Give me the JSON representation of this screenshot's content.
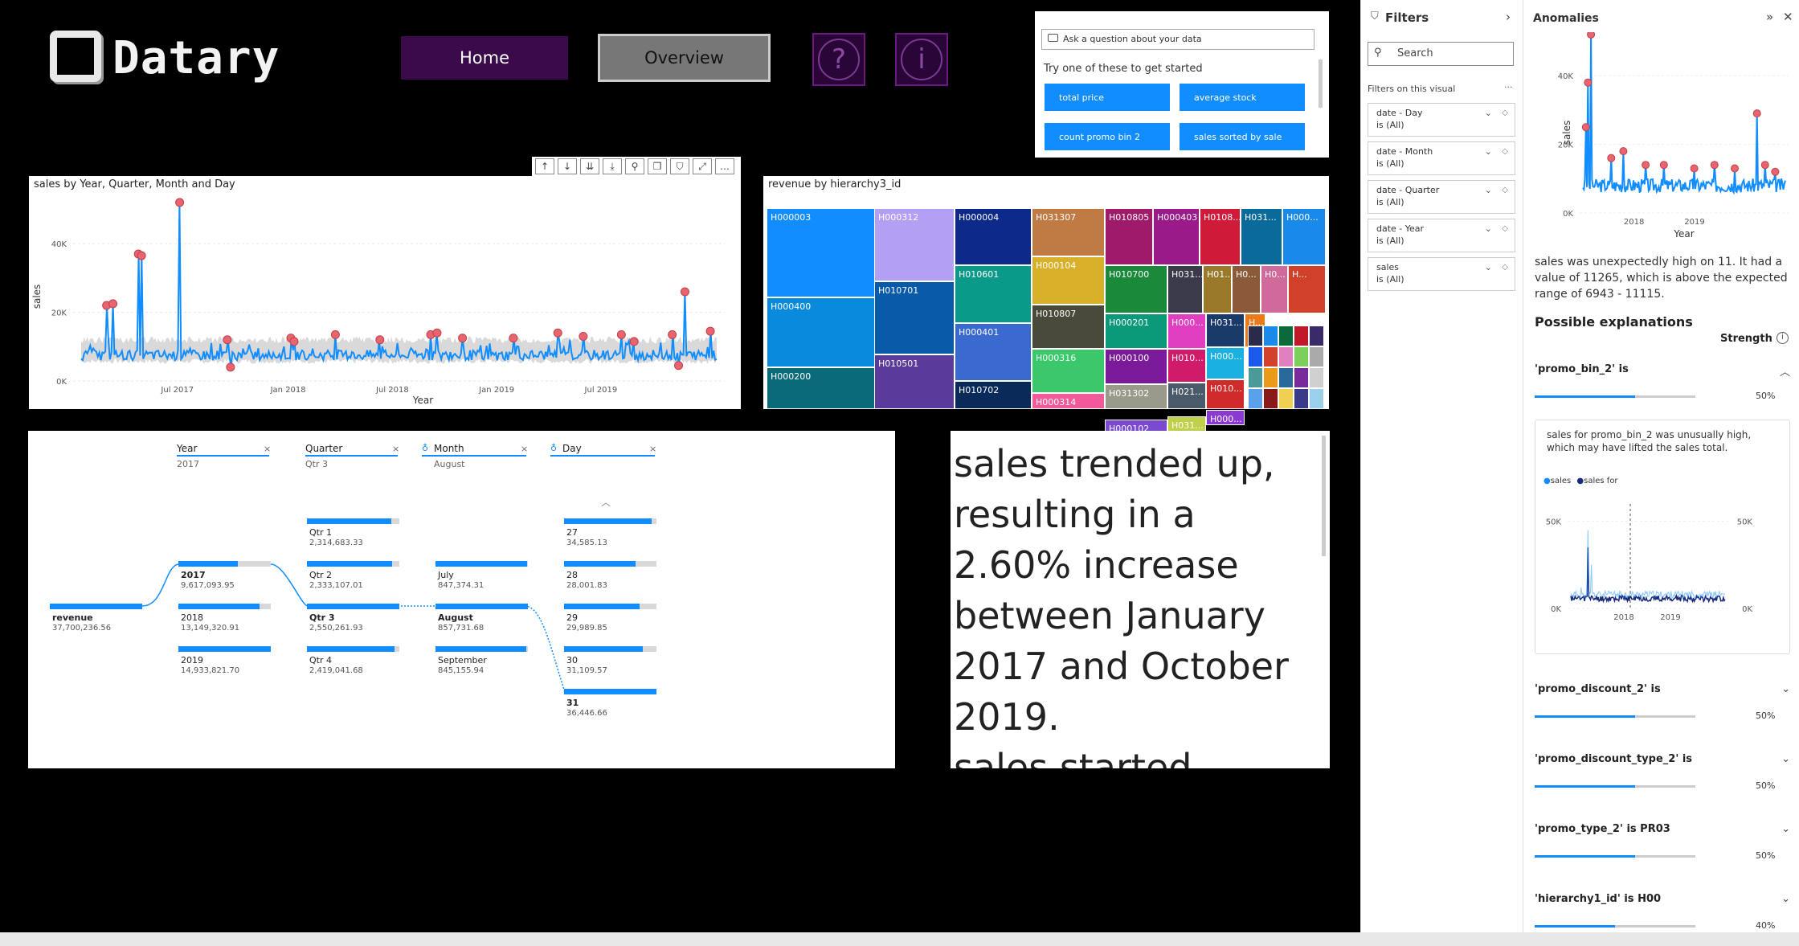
{
  "app": {
    "logo_text": "Datary",
    "nav": {
      "home": "Home",
      "overview": "Overview"
    },
    "help_icon": "question-icon",
    "info_icon": "info-icon"
  },
  "qa": {
    "placeholder": "Ask a question about your data",
    "hint": "Try one of these to get started",
    "suggestions": [
      "total price",
      "average stock",
      "count promo bin 2",
      "sales sorted by sale"
    ]
  },
  "line_visual": {
    "title": "sales by Year, Quarter, Month and Day",
    "toolbar_icons": [
      "drill-up-icon",
      "drill-down-icon",
      "expand-all-icon",
      "expand-next-icon",
      "pin-icon",
      "copy-icon",
      "filter-icon",
      "focus-icon",
      "more-icon"
    ]
  },
  "chart_data": [
    {
      "type": "line",
      "title": "sales by Year, Quarter, Month and Day",
      "xlabel": "Year",
      "ylabel": "sales",
      "x_ticks": [
        "Jul 2017",
        "Jan 2018",
        "Jul 2018",
        "Jan 2019",
        "Jul 2019"
      ],
      "y_ticks": [
        "0K",
        "20K",
        "40K"
      ],
      "ylim": [
        0,
        48000
      ],
      "baseline_range": [
        6000,
        9000
      ],
      "spikes": [
        {
          "x": 0.04,
          "y": 22000
        },
        {
          "x": 0.05,
          "y": 22500
        },
        {
          "x": 0.09,
          "y": 37000
        },
        {
          "x": 0.095,
          "y": 36500
        },
        {
          "x": 0.155,
          "y": 52000
        },
        {
          "x": 0.23,
          "y": 12000
        },
        {
          "x": 0.235,
          "y": 4000
        },
        {
          "x": 0.33,
          "y": 12500
        },
        {
          "x": 0.335,
          "y": 11500
        },
        {
          "x": 0.4,
          "y": 13500
        },
        {
          "x": 0.47,
          "y": 12000
        },
        {
          "x": 0.55,
          "y": 13500
        },
        {
          "x": 0.56,
          "y": 14000
        },
        {
          "x": 0.6,
          "y": 12500
        },
        {
          "x": 0.68,
          "y": 12500
        },
        {
          "x": 0.75,
          "y": 14000
        },
        {
          "x": 0.79,
          "y": 13000
        },
        {
          "x": 0.85,
          "y": 13500
        },
        {
          "x": 0.87,
          "y": 11500
        },
        {
          "x": 0.93,
          "y": 13500
        },
        {
          "x": 0.95,
          "y": 26000
        },
        {
          "x": 0.94,
          "y": 4500
        },
        {
          "x": 0.99,
          "y": 14500
        }
      ]
    },
    {
      "type": "line",
      "title": "Anomalies",
      "xlabel": "Year",
      "ylabel": "sales",
      "x_ticks": [
        "2018",
        "2019"
      ],
      "y_ticks": [
        "0K",
        "20K",
        "40K"
      ]
    },
    {
      "type": "line",
      "title": "sales for promo_bin_2",
      "legend": [
        "sales",
        "sales for"
      ],
      "x_ticks": [
        "2018",
        "2019"
      ],
      "y_ticks": [
        "0K",
        "50K"
      ]
    }
  ],
  "treemap": {
    "title": "revenue by hierarchy3_id",
    "labels": [
      "H000003",
      "H000312",
      "H000004",
      "H031307",
      "H010805",
      "H000403",
      "H0108...",
      "H031...",
      "H000...",
      "H000400",
      "H010701",
      "H010601",
      "H000104",
      "H010700",
      "H031...",
      "H01...",
      "H0...",
      "H0...",
      "H...",
      "H000401",
      "H010807",
      "H000201",
      "H000...",
      "H031...",
      "H...",
      "H000200",
      "H010501",
      "H010702",
      "H000316",
      "H000100",
      "H010...",
      "H000...",
      "H031302",
      "H021...",
      "H010...",
      "H000314",
      "H000102",
      "H031...",
      "H000...",
      "H000..."
    ]
  },
  "decomp": {
    "columns": [
      {
        "head": "Year",
        "sub": "2017"
      },
      {
        "head": "Quarter",
        "sub": "Qtr 3"
      },
      {
        "head": "Month",
        "sub": "August"
      },
      {
        "head": "Day",
        "sub": ""
      }
    ],
    "root": {
      "label": "revenue",
      "value": "37,700,236.56"
    },
    "years": [
      {
        "label": "2017",
        "value": "9,617,093.95"
      },
      {
        "label": "2018",
        "value": "13,149,320.91"
      },
      {
        "label": "2019",
        "value": "14,933,821.70"
      }
    ],
    "quarters": [
      {
        "label": "Qtr 1",
        "value": "2,314,683.33"
      },
      {
        "label": "Qtr 2",
        "value": "2,333,107.01"
      },
      {
        "label": "Qtr 3",
        "value": "2,550,261.93"
      },
      {
        "label": "Qtr 4",
        "value": "2,419,041.68"
      }
    ],
    "months": [
      {
        "label": "July",
        "value": "847,374.31"
      },
      {
        "label": "August",
        "value": "857,731.68"
      },
      {
        "label": "September",
        "value": "845,155.94"
      }
    ],
    "days": [
      {
        "label": "27",
        "value": "34,585.13"
      },
      {
        "label": "28",
        "value": "28,001.83"
      },
      {
        "label": "29",
        "value": "29,989.85"
      },
      {
        "label": "30",
        "value": "31,109.57"
      },
      {
        "label": "31",
        "value": "36,446.66"
      }
    ]
  },
  "narrative": {
    "text": "sales trended up, resulting in a 2.60% increase between January 2017 and October 2019.",
    "cut_text": "sales started trending"
  },
  "filters": {
    "title": "Filters",
    "search_placeholder": "Search",
    "section": "Filters on this visual",
    "cards": [
      {
        "name": "date - Day",
        "state": "is (All)"
      },
      {
        "name": "date - Month",
        "state": "is (All)"
      },
      {
        "name": "date - Quarter",
        "state": "is (All)"
      },
      {
        "name": "date - Year",
        "state": "is (All)"
      },
      {
        "name": "sales",
        "state": "is (All)"
      }
    ]
  },
  "anomalies": {
    "title": "Anomalies",
    "description": "sales was unexpectedly high on 11. It had a value of 11265, which is above the expected range of 6943 - 11115.",
    "explanations_title": "Possible explanations",
    "strength_label": "Strength",
    "detail_text": "sales for promo_bin_2 was unusually high, which may have lifted the sales total.",
    "items": [
      {
        "title": "'promo_bin_2' is",
        "pct": "50%"
      },
      {
        "title": "'promo_discount_2' is",
        "pct": "50%"
      },
      {
        "title": "'promo_discount_type_2' is",
        "pct": "50%"
      },
      {
        "title": "'promo_type_2' is PR03",
        "pct": "50%"
      },
      {
        "title": "'hierarchy1_id' is H00",
        "pct": "40%"
      }
    ]
  },
  "colors": {
    "accent": "#118dff",
    "anomaly": "#e8646e",
    "nav_purple": "#3a0a4a"
  }
}
